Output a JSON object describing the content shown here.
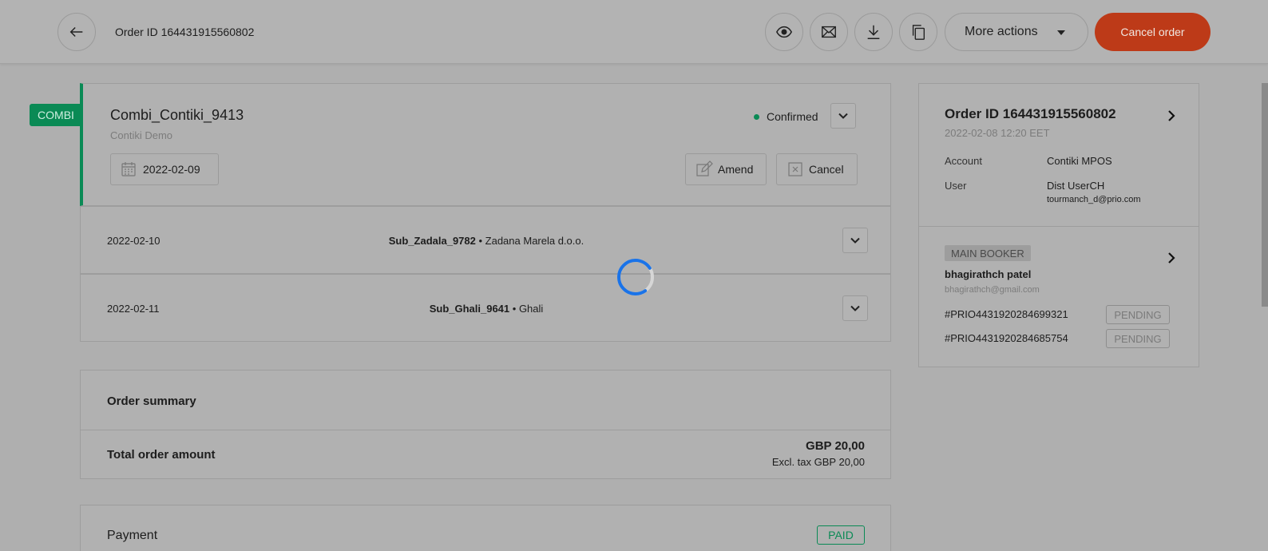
{
  "header": {
    "order_title": "Order ID 164431915560802",
    "more_actions_label": "More actions",
    "cancel_order_label": "Cancel order"
  },
  "icons": {
    "back": "arrow-left-icon",
    "preview": "eye-icon",
    "email": "envelope-icon",
    "download": "download-icon",
    "copy": "copy-icon"
  },
  "main_product": {
    "tag": "COMBI",
    "name": "Combi_Contiki_9413",
    "supplier": "Contiki Demo",
    "status": "Confirmed",
    "date": "2022-02-09",
    "amend_label": "Amend",
    "cancel_label": "Cancel"
  },
  "sub_products": [
    {
      "date": "2022-02-10",
      "name": "Sub_Zadala_9782",
      "separator": " • ",
      "supplier": "Zadana Marela d.o.o."
    },
    {
      "date": "2022-02-11",
      "name": "Sub_Ghali_9641",
      "separator": " • ",
      "supplier": "Ghali"
    }
  ],
  "summary": {
    "title": "Order summary",
    "total_label": "Total order amount",
    "total_value": "GBP 20,00",
    "excl_tax": "Excl. tax GBP 20,00"
  },
  "payment": {
    "title": "Payment",
    "status": "PAID"
  },
  "sidebar": {
    "order_id": "Order ID 164431915560802",
    "order_date": "2022-02-08 12:20 EET",
    "account_label": "Account",
    "account_value": "Contiki MPOS",
    "user_label": "User",
    "user_value": "Dist UserCH",
    "user_email": "tourmanch_d@prio.com",
    "booker_badge": "MAIN BOOKER",
    "booker_name": "bhagirathch patel",
    "booker_email": "bhagirathch@gmail.com",
    "references": [
      {
        "id": "#PRIO4431920284699321",
        "status": "PENDING"
      },
      {
        "id": "#PRIO4431920284685754",
        "status": "PENDING"
      }
    ]
  },
  "colors": {
    "accent_green": "#0a8a55",
    "cancel_red": "#bd3a18",
    "spinner_blue": "#1a73e8"
  }
}
